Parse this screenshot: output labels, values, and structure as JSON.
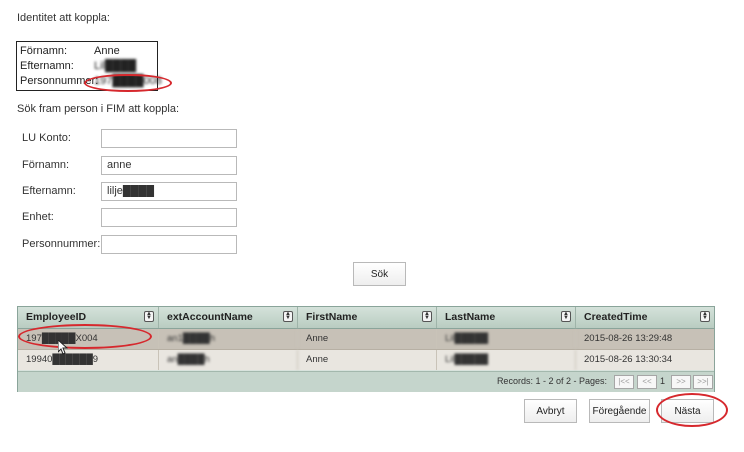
{
  "identity": {
    "heading": "Identitet att koppla:",
    "rows": [
      {
        "label": "Förnamn:",
        "value": "Anne"
      },
      {
        "label": "Efternamn:",
        "value": "Lil████"
      },
      {
        "label": "Personnummer:",
        "value": "197████008"
      }
    ]
  },
  "search": {
    "heading": "Sök fram person i FIM att koppla:",
    "fields": [
      {
        "label": "LU Konto:",
        "value": ""
      },
      {
        "label": "Förnamn:",
        "value": "anne"
      },
      {
        "label": "Efternamn:",
        "value": "lilje████"
      },
      {
        "label": "Enhet:",
        "value": ""
      },
      {
        "label": "Personnummer:",
        "value": ""
      }
    ],
    "search_button": "Sök"
  },
  "grid": {
    "columns": [
      "EmployeeID",
      "extAccountName",
      "FirstName",
      "LastName",
      "CreatedTime"
    ],
    "rows": [
      [
        "197█████X004",
        "an1████h",
        "Anne",
        "Lil█████",
        "2015-08-26 13:29:48"
      ],
      [
        "19940██████9",
        "an████h",
        "Anne",
        "Lil█████",
        "2015-08-26 13:30:34"
      ]
    ],
    "sort_icon": "sort-updown-icon",
    "pager": {
      "records_text": "Records: 1 - 2 of 2 - Pages:",
      "first": "|<<",
      "prev": "<<",
      "current_page": "1",
      "next": ">>",
      "last": ">>|"
    }
  },
  "actions": {
    "cancel": "Avbryt",
    "previous": "Föregående",
    "next": "Nästa"
  },
  "colors": {
    "highlight_ellipse": "#d6282d",
    "grid_header": "#b9ccc1",
    "selected_row": "#c7c1b7"
  }
}
